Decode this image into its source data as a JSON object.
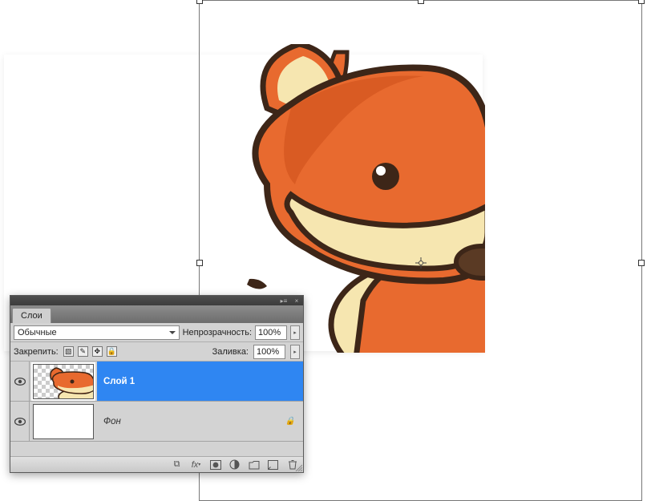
{
  "panel": {
    "tab_label": "Слои",
    "blend_mode": "Обычные",
    "opacity_label": "Непрозрачность:",
    "opacity_value": "100%",
    "lock_label": "Закрепить:",
    "fill_label": "Заливка:",
    "fill_value": "100%"
  },
  "layers": [
    {
      "name": "Слой 1",
      "visible": true,
      "selected": true,
      "locked": false,
      "thumb": "fox-checker"
    },
    {
      "name": "Фон",
      "visible": true,
      "selected": false,
      "locked": true,
      "thumb": "white"
    }
  ],
  "footer_icons": [
    "link-icon",
    "fx-icon",
    "mask-icon",
    "adjustment-icon",
    "group-icon",
    "new-layer-icon",
    "trash-icon"
  ],
  "colors": {
    "selection": "#2f86f2",
    "panel_bg": "#d3d3d3",
    "fox_orange": "#e86a2f",
    "fox_cream": "#f6e6b0",
    "fox_outline": "#3d2618"
  }
}
